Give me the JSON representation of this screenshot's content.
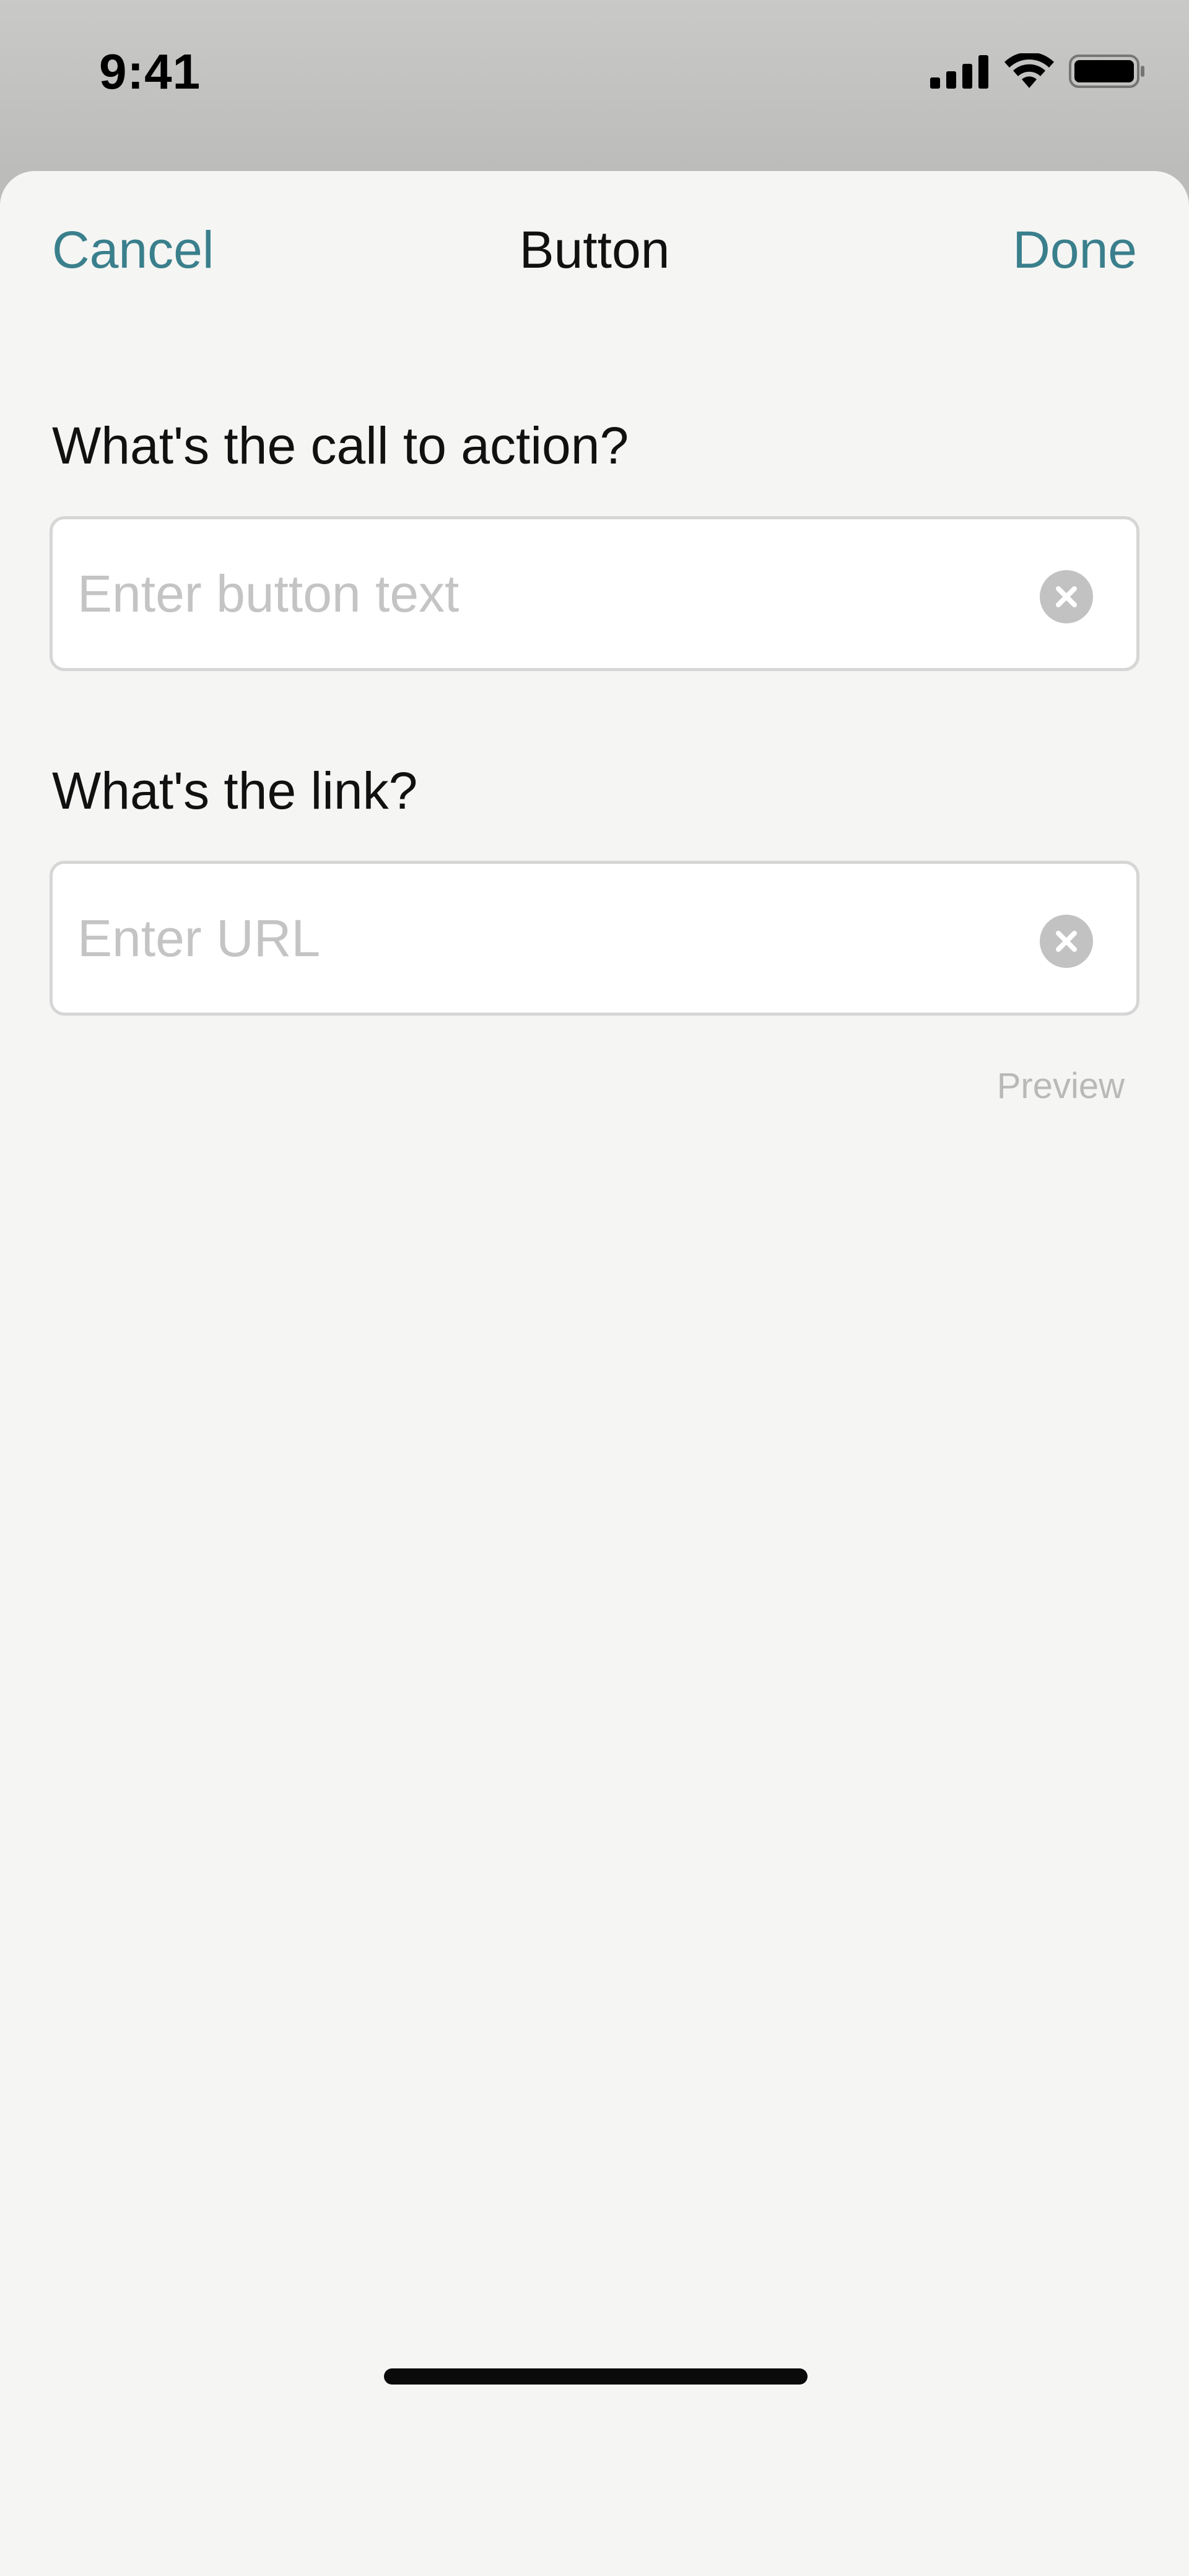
{
  "status_bar": {
    "time": "9:41",
    "icons": [
      "cellular-signal-icon",
      "wifi-icon",
      "battery-icon"
    ]
  },
  "nav": {
    "cancel_label": "Cancel",
    "title": "Button",
    "done_label": "Done"
  },
  "fields": [
    {
      "label": "What's the call to action?",
      "placeholder": "Enter button text",
      "value": ""
    },
    {
      "label": "What's the link?",
      "placeholder": "Enter URL",
      "value": ""
    }
  ],
  "preview_label": "Preview",
  "colors": {
    "accent": "#3a7f8c",
    "sheet_background": "#f5f5f3",
    "placeholder": "#c4c4c4",
    "disabled_text": "#b9b9b9"
  }
}
